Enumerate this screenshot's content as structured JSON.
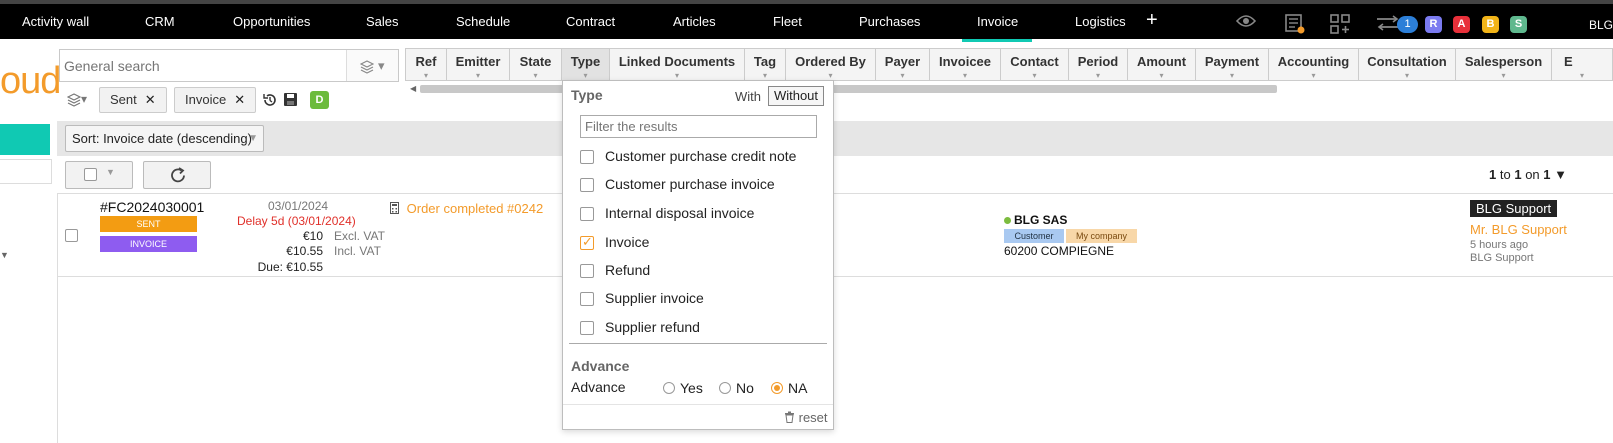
{
  "nav": {
    "items": [
      "Activity wall",
      "CRM",
      "Opportunities",
      "Sales",
      "Schedule",
      "Contract",
      "Articles",
      "Fleet",
      "Purchases",
      "Invoice",
      "Logistics"
    ],
    "active": "Invoice",
    "plus": "+"
  },
  "topbar": {
    "notif_count": "1",
    "user_bubbles": [
      {
        "letter": "R",
        "color": "#7b7bf0"
      },
      {
        "letter": "A",
        "color": "#e8303a"
      },
      {
        "letter": "B",
        "color": "#f2b418"
      },
      {
        "letter": "S",
        "color": "#5fb88e"
      }
    ],
    "user_name": "BLG"
  },
  "app": {
    "logo_text": "oud",
    "search_placeholder": "General search",
    "filter_chips": [
      "Sent",
      "Invoice"
    ],
    "chip_close": "✕",
    "saved_filter_badge": "D",
    "sort_label": "Sort: Invoice date (descending)",
    "pager": {
      "from": "1",
      "to_word": "to",
      "to": "1",
      "on_word": "on",
      "total": "1"
    }
  },
  "columns": [
    "Ref",
    "Emitter",
    "State",
    "Type",
    "Linked Documents",
    "Tag",
    "Ordered By",
    "Payer",
    "Invoicee",
    "Contact",
    "Period",
    "Amount",
    "Payment",
    "Accounting",
    "Consultation",
    "Salesperson",
    "E"
  ],
  "row": {
    "ref": "#FC2024030001",
    "badges": [
      "SENT",
      "INVOICE"
    ],
    "date": "03/01/2024",
    "delay": "Delay 5d (03/01/2024)",
    "amount_excl": "€10",
    "amount_excl_label": "Excl. VAT",
    "amount_incl": "€10.55",
    "amount_incl_label": "Incl. VAT",
    "due": "Due: €10.55",
    "order_link": "Order completed #0242",
    "company": "BLG SAS",
    "tags": [
      "Customer",
      "My company"
    ],
    "city": "60200 COMPIEGNE",
    "salesperson_badge": "BLG Support",
    "salesperson_link": "Mr. BLG Support",
    "time_ago": "5 hours ago",
    "by": "BLG Support"
  },
  "dropdown": {
    "title": "Type",
    "with_label": "With",
    "without_label": "Without",
    "filter_placeholder": "Filter the results",
    "options": [
      {
        "label": "Customer purchase credit note",
        "checked": false
      },
      {
        "label": "Customer purchase invoice",
        "checked": false
      },
      {
        "label": "Internal disposal invoice",
        "checked": false
      },
      {
        "label": "Invoice",
        "checked": true
      },
      {
        "label": "Refund",
        "checked": false
      },
      {
        "label": "Supplier invoice",
        "checked": false
      },
      {
        "label": "Supplier refund",
        "checked": false
      }
    ],
    "advance_title": "Advance",
    "advance_label": "Advance",
    "advance_options": [
      "Yes",
      "No",
      "NA"
    ],
    "advance_selected": "NA",
    "reset_label": "reset"
  }
}
